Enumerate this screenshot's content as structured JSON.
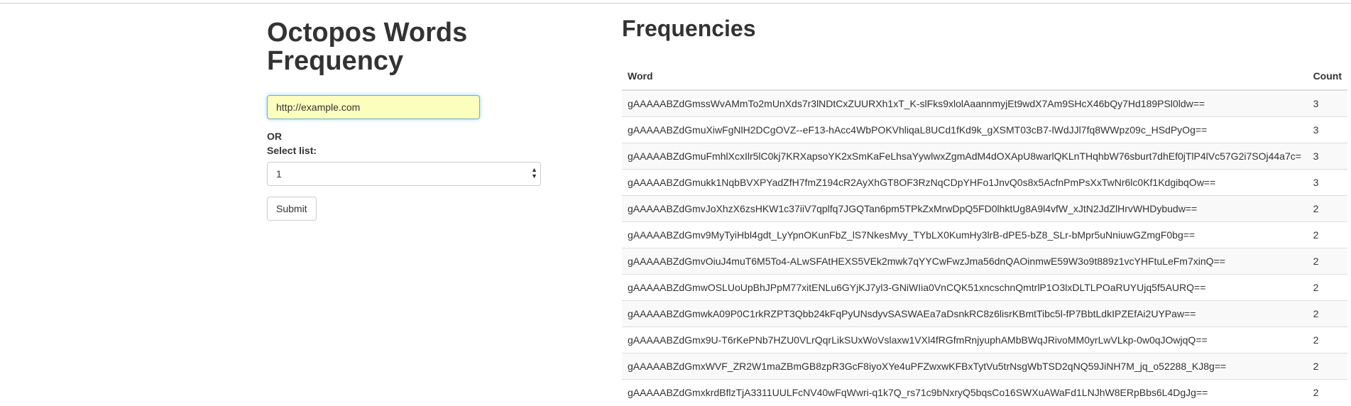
{
  "form": {
    "title": "Octopos Words Frequency",
    "url_value": "http://example.com",
    "or_label": "OR",
    "select_label": "Select list:",
    "select_value": "1",
    "submit_label": "Submit"
  },
  "results": {
    "title": "Frequencies",
    "columns": [
      "Word",
      "Count"
    ],
    "rows": [
      {
        "word": "gAAAAABZdGmssWvAMmTo2mUnXds7r3lNDtCxZUURXh1xT_K-slFks9xlolAaannmyjEt9wdX7Am9SHcX46bQy7Hd189PSl0ldw==",
        "count": "3"
      },
      {
        "word": "gAAAAABZdGmuXiwFgNlH2DCgOVZ--eF13-hAcc4WbPOKVhliqaL8UCd1fKd9k_gXSMT03cB7-lWdJJl7fq8WWpz09c_HSdPyOg==",
        "count": "3"
      },
      {
        "word": "gAAAAABZdGmuFmhlXcxIlr5lC0kj7KRXapsoYK2xSmKaFeLhsaYywlwxZgmAdM4dOXApU8warlQKLnTHqhbW76sburt7dhEf0jTlP4lVc57G2i7SOj44a7c=",
        "count": "3"
      },
      {
        "word": "gAAAAABZdGmukk1NqbBVXPYadZfH7fmZ194cR2AyXhGT8OF3RzNqCDpYHFo1JnvQ0s8x5AcfnPmPsXxTwNr6lc0Kf1KdgibqOw==",
        "count": "3"
      },
      {
        "word": "gAAAAABZdGmvJoXhzX6zsHKW1c37iiV7qplfq7JGQTan6pm5TPkZxMrwDpQ5FD0lhktUg8A9l4vfW_xJtN2JdZlHrvWHDybudw==",
        "count": "2"
      },
      {
        "word": "gAAAAABZdGmv9MyTyiHbl4gdt_LyYpnOKunFbZ_lS7NkesMvy_TYbLX0KumHy3lrB-dPE5-bZ8_SLr-bMpr5uNniuwGZmgF0bg==",
        "count": "2"
      },
      {
        "word": "gAAAAABZdGmvOiuJ4muT6M5To4-ALwSFAtHEXS5VEk2mwk7qYYCwFwzJma56dnQAOinmwE59W3o9t889z1vcYHFtuLeFm7xinQ==",
        "count": "2"
      },
      {
        "word": "gAAAAABZdGmwOSLUoUpBhJPpM77xitENLu6GYjKJ7yl3-GNiWIia0VnCQK51xncschnQmtrlP1O3lxDLTLPOaRUYUjq5f5AURQ==",
        "count": "2"
      },
      {
        "word": "gAAAAABZdGmwkA09P0C1rkRZPT3Qbb24kFqPyUNsdyvSASWAEa7aDsnkRC8z6lisrKBmtTibc5l-fP7BbtLdkIPZEfAi2UYPaw==",
        "count": "2"
      },
      {
        "word": "gAAAAABZdGmx9U-T6rKePNb7HZU0VLrQqrLikSUxWoVslaxw1VXl4fRGfmRnjyuphAMbBWqJRivoMM0yrLwVLkp-0w0qJOwjqQ==",
        "count": "2"
      },
      {
        "word": "gAAAAABZdGmxWVF_ZR2W1maZBmGB8zpR3GcF8iyoXYe4uPFZwxwKFBxTytVu5trNsgWbTSD2qNQ59JiNH7M_jq_o52288_KJ8g==",
        "count": "2"
      },
      {
        "word": "gAAAAABZdGmxkrdBflzTjA3311UULFcNV40wFqWwri-q1k7Q_rs71c9bNxryQ5bqsCo16SWXuAWaFd1LNJhW8ERpBbs6L4DgJg==",
        "count": "2"
      }
    ]
  }
}
